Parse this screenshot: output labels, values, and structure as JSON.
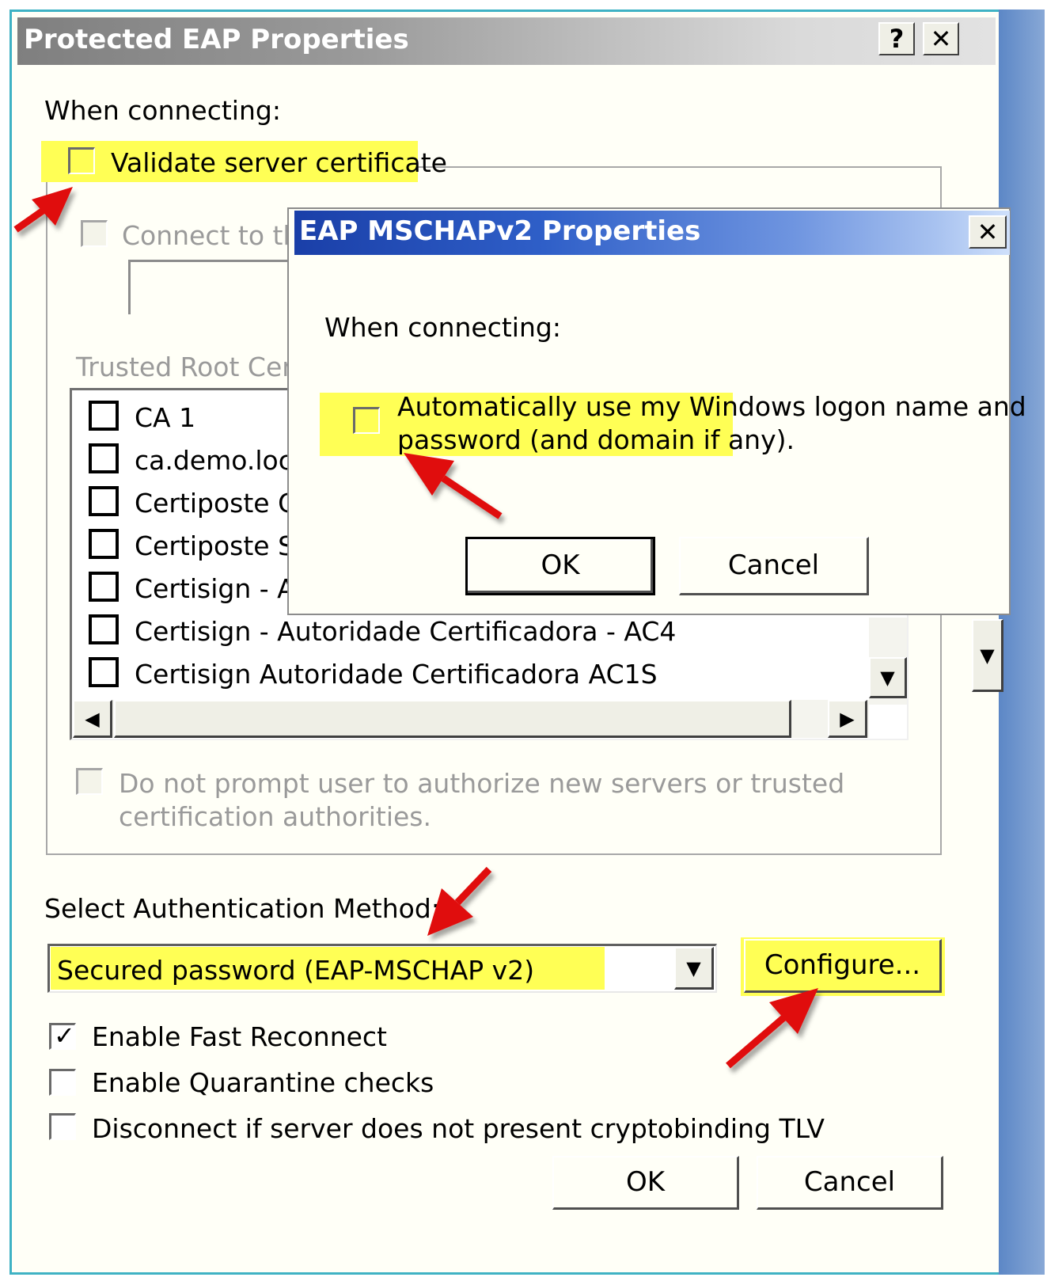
{
  "outer_dialog": {
    "title": "Protected EAP Properties",
    "help_button": "?",
    "close_button": "✕",
    "when_connecting": "When connecting:",
    "validate_server_certificate": "Validate server certificate",
    "connect_to_servers": "Connect to th",
    "trusted_root": "Trusted Root Cer",
    "certificate_authorities": [
      {
        "label": "CA 1",
        "checked": false
      },
      {
        "label": "ca.demo.loca",
        "checked": false
      },
      {
        "label": "Certiposte C",
        "checked": false
      },
      {
        "label": "Certiposte S",
        "checked": false
      },
      {
        "label": "Certisign - A",
        "checked": false
      },
      {
        "label": "Certisign - Autoridade Certificadora - AC4",
        "checked": false
      },
      {
        "label": "Certisign Autoridade Certificadora AC1S",
        "checked": false
      }
    ],
    "do_not_prompt_line1": "Do not prompt user to authorize new servers or trusted",
    "do_not_prompt_line2": "certification authorities.",
    "select_auth_method": "Select Authentication Method:",
    "auth_method_value": "Secured password (EAP-MSCHAP v2)",
    "configure_button": "Configure...",
    "enable_fast_reconnect": "Enable Fast Reconnect",
    "enable_fast_reconnect_checked": true,
    "enable_quarantine": "Enable Quarantine checks",
    "disconnect_cryptobinding": "Disconnect if server does not present cryptobinding TLV",
    "ok_button": "OK",
    "cancel_button": "Cancel"
  },
  "inner_dialog": {
    "title": "EAP MSCHAPv2 Properties",
    "close_button": "✕",
    "when_connecting": "When connecting:",
    "auto_logon_line1": "Automatically use my Windows logon name and",
    "auto_logon_line2": "password (and domain if any).",
    "ok_button": "OK",
    "cancel_button": "Cancel"
  },
  "colors": {
    "highlight": "#ffff55",
    "annotation_arrow": "#e01010",
    "inner_title_bar": "#1a3fa8",
    "outer_border": "#3fb2c4"
  }
}
